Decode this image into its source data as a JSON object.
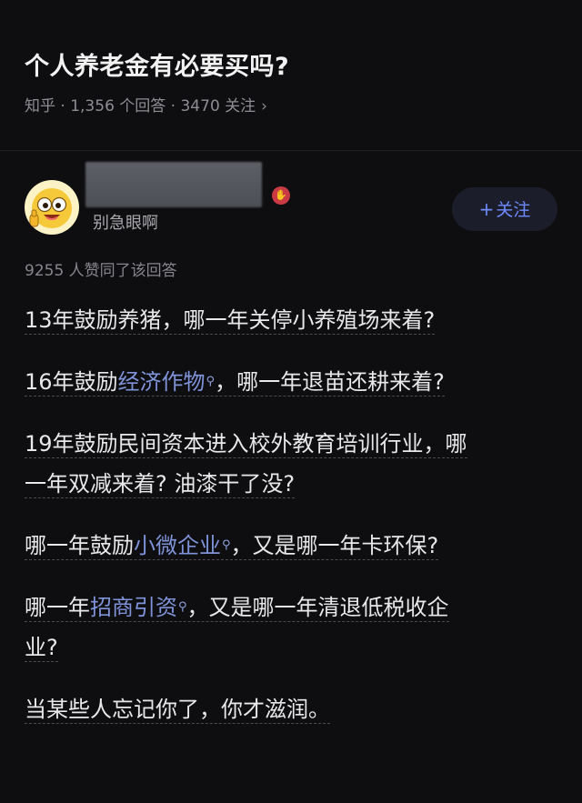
{
  "question": {
    "title": "个人养老金有必要买吗?",
    "meta": "知乎 · 1,356 个回答 · 3470 关注",
    "chevron": "›"
  },
  "author": {
    "subtitle": "别急眼啊",
    "badge_icon": "hand-badge-icon",
    "follow_plus": "+",
    "follow_label": "关注",
    "avatar_icon": "emoji-thumbs-up-avatar"
  },
  "answer": {
    "likes": "9255 人赞同了该回答",
    "p1": "13年鼓励养猪，哪一年关停小养殖场来着?",
    "p2_a": "16年鼓励",
    "p2_link": "经济作物",
    "p2_b": "，哪一年退苗还耕来着?",
    "p3_line1": "19年鼓励民间资本进入校外教育培训行业，哪",
    "p3_line2": "一年双减来着? 油漆干了没?",
    "p4_a": "哪一年鼓励",
    "p4_link": "小微企业",
    "p4_b": "，又是哪一年卡环保?",
    "p5_a": "哪一年",
    "p5_link": "招商引资",
    "p5_b_line1": "，又是哪一年清退低税收企",
    "p5_b_line2": "业?",
    "p6": "当某些人忘记你了，你才滋润。",
    "search_glyph": "⚲"
  },
  "colors": {
    "background": "#0e0e10",
    "link": "#7f93d9",
    "follow_text": "#6f8cff",
    "meta": "#8d8d93"
  }
}
